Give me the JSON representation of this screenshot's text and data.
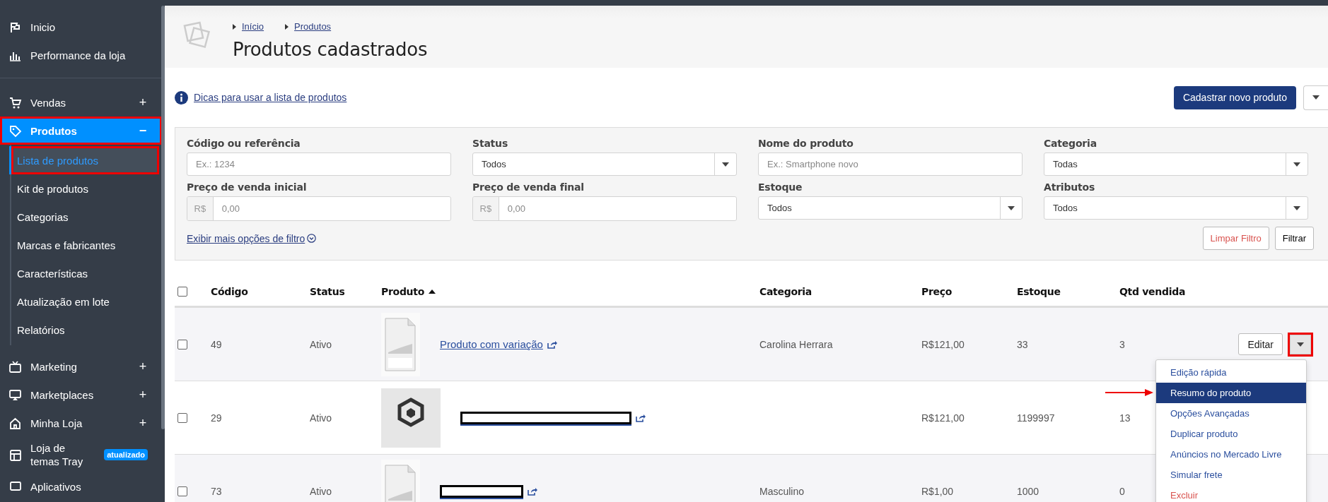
{
  "sidebar": {
    "items": [
      {
        "label": "Inicio",
        "selected": false
      },
      {
        "label": "Performance da loja",
        "selected": false
      },
      {
        "label": "Vendas",
        "toggle": "+",
        "selected": false
      },
      {
        "label": "Produtos",
        "toggle": "−",
        "expanded": true,
        "selected": true,
        "highlighted": true,
        "children": [
          {
            "label": "Lista de produtos",
            "selected": true,
            "highlighted": true
          },
          {
            "label": "Kit de produtos",
            "selected": false
          },
          {
            "label": "Categorias",
            "selected": false
          },
          {
            "label": "Marcas e fabricantes",
            "selected": false
          },
          {
            "label": "Características",
            "selected": false
          },
          {
            "label": "Atualização em lote",
            "selected": false
          },
          {
            "label": "Relatórios",
            "selected": false
          }
        ]
      },
      {
        "label": "Marketing",
        "toggle": "+",
        "selected": false
      },
      {
        "label": "Marketplaces",
        "toggle": "+",
        "selected": false
      },
      {
        "label": "Minha Loja",
        "toggle": "+",
        "selected": false
      },
      {
        "label": "Loja de temas Tray",
        "badge": "atualizado",
        "selected": false
      },
      {
        "label": "Aplicativos",
        "selected": false
      }
    ]
  },
  "header": {
    "breadcrumb": [
      "Início",
      "Produtos"
    ],
    "title": "Produtos cadastrados"
  },
  "tips_link": "Dicas para usar a lista de produtos",
  "new_button": "Cadastrar novo produto",
  "filters": {
    "fields": [
      {
        "kind": "text",
        "label": "Código ou referência",
        "placeholder": "Ex.: 1234"
      },
      {
        "kind": "select",
        "label": "Status",
        "value": "Todos"
      },
      {
        "kind": "text",
        "label": "Nome do produto",
        "placeholder": "Ex.: Smartphone novo"
      },
      {
        "kind": "select",
        "label": "Categoria",
        "value": "Todas"
      },
      {
        "kind": "currency",
        "label": "Preço de venda inicial",
        "prefix": "R$",
        "placeholder": "0,00"
      },
      {
        "kind": "currency",
        "label": "Preço de venda final",
        "prefix": "R$",
        "placeholder": "0,00"
      },
      {
        "kind": "select",
        "label": "Estoque",
        "value": "Todos"
      },
      {
        "kind": "select",
        "label": "Atributos",
        "value": "Todos"
      }
    ],
    "more_link": "Exibir mais opções de filtro",
    "clear_button": "Limpar Filtro",
    "apply_button": "Filtrar"
  },
  "table": {
    "select_all": false,
    "columns": [
      {
        "label": "Código"
      },
      {
        "label": "Status"
      },
      {
        "label": "Produto",
        "sorted": true
      },
      {
        "label": "Categoria"
      },
      {
        "label": "Preço"
      },
      {
        "label": "Estoque"
      },
      {
        "label": "Qtd vendida"
      }
    ],
    "rows": [
      {
        "checked": false,
        "code": "49",
        "status": "Ativo",
        "kind": "no_image",
        "product": "Produto com variação",
        "category": "Carolina Herrara",
        "price": "R$121,00",
        "stock": "33",
        "sold": "3",
        "edit": "Editar",
        "menu_open": true,
        "toggle_highlighted": true
      },
      {
        "checked": false,
        "code": "29",
        "status": "Ativo",
        "kind": "sample_image",
        "redacted": true,
        "price": "R$121,00",
        "stock": "1199997",
        "sold": "13"
      },
      {
        "checked": false,
        "code": "73",
        "status": "Ativo",
        "kind": "no_image",
        "redacted": true,
        "category": "Masculino",
        "price": "R$1,00",
        "stock": "1000",
        "sold": "0"
      }
    ]
  },
  "row_menu": {
    "items": [
      {
        "label": "Edição rápida",
        "kind": "normal",
        "selected": false,
        "pointed": false
      },
      {
        "label": "Resumo do produto",
        "kind": "normal",
        "selected": true,
        "pointed": true
      },
      {
        "label": "Opções Avançadas",
        "kind": "normal",
        "selected": false,
        "pointed": false
      },
      {
        "label": "Duplicar produto",
        "kind": "normal",
        "selected": false,
        "pointed": false
      },
      {
        "label": "Anúncios no Mercado Livre",
        "kind": "normal",
        "selected": false,
        "pointed": false
      },
      {
        "label": "Simular frete",
        "kind": "normal",
        "selected": false,
        "pointed": false
      },
      {
        "label": "Excluir",
        "kind": "danger",
        "selected": false,
        "pointed": false
      }
    ]
  }
}
